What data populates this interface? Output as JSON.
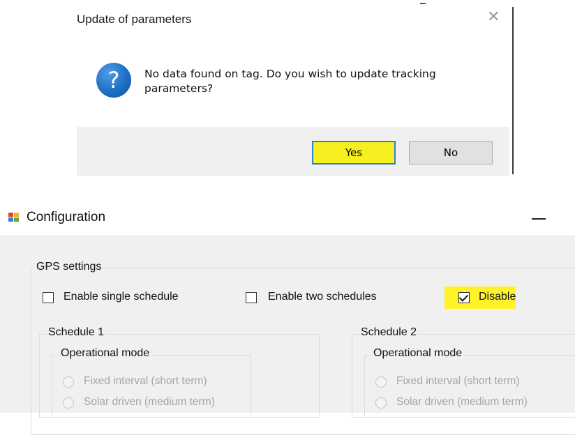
{
  "dialog": {
    "title": "Update of parameters",
    "close_glyph": "✕",
    "icon": "question-icon",
    "icon_glyph": "?",
    "message": "No data found on tag. Do you wish to update tracking parameters?",
    "buttons": {
      "yes": "Yes",
      "no": "No"
    },
    "highlight_color": "#f7ef1f"
  },
  "config": {
    "title": "Configuration",
    "icon": "app-icon",
    "gps_group": {
      "label": "GPS settings",
      "options": [
        {
          "label": "Enable single schedule",
          "checked": false
        },
        {
          "label": "Enable two schedules",
          "checked": false
        },
        {
          "label": "Disable",
          "checked": true
        }
      ]
    },
    "schedules": [
      {
        "label": "Schedule 1",
        "mode_group": "Operational mode",
        "modes": [
          "Fixed interval (short term)",
          "Solar driven (medium term)"
        ]
      },
      {
        "label": "Schedule 2",
        "mode_group": "Operational mode",
        "modes": [
          "Fixed interval (short term)",
          "Solar driven (medium term)"
        ]
      }
    ]
  }
}
